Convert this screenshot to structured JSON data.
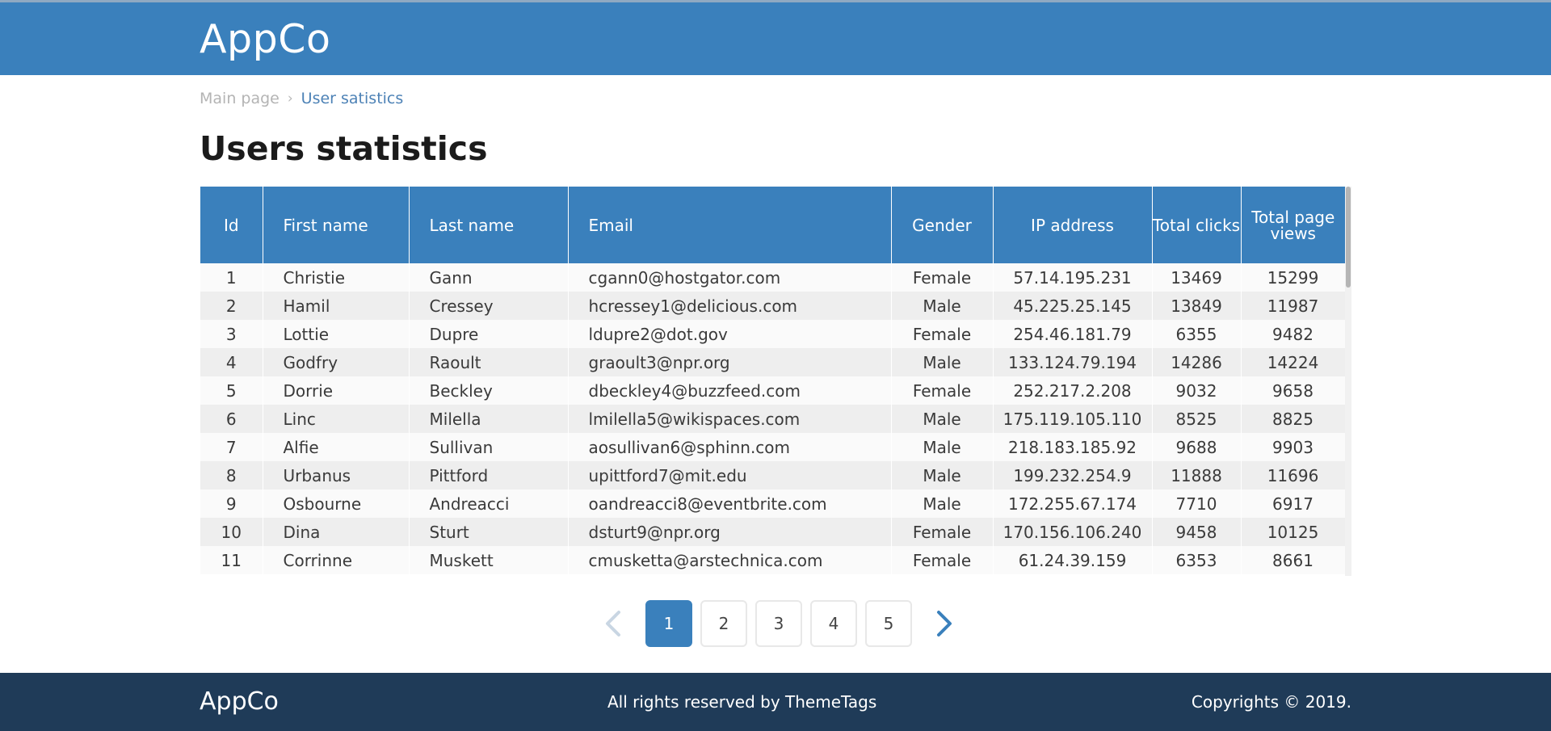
{
  "header": {
    "brand": "AppCo"
  },
  "breadcrumb": {
    "home": "Main page",
    "separator": "›",
    "current": "User satistics"
  },
  "page": {
    "title": "Users statistics"
  },
  "table": {
    "headers": [
      "Id",
      "First name",
      "Last name",
      "Email",
      "Gender",
      "IP address",
      "Total clicks",
      "Total page views"
    ],
    "rows": [
      [
        "1",
        "Christie",
        "Gann",
        "cgann0@hostgator.com",
        "Female",
        "57.14.195.231",
        "13469",
        "15299"
      ],
      [
        "2",
        "Hamil",
        "Cressey",
        "hcressey1@delicious.com",
        "Male",
        "45.225.25.145",
        "13849",
        "11987"
      ],
      [
        "3",
        "Lottie",
        "Dupre",
        "ldupre2@dot.gov",
        "Female",
        "254.46.181.79",
        "6355",
        "9482"
      ],
      [
        "4",
        "Godfry",
        "Raoult",
        "graoult3@npr.org",
        "Male",
        "133.124.79.194",
        "14286",
        "14224"
      ],
      [
        "5",
        "Dorrie",
        "Beckley",
        "dbeckley4@buzzfeed.com",
        "Female",
        "252.217.2.208",
        "9032",
        "9658"
      ],
      [
        "6",
        "Linc",
        "Milella",
        "lmilella5@wikispaces.com",
        "Male",
        "175.119.105.110",
        "8525",
        "8825"
      ],
      [
        "7",
        "Alfie",
        "Sullivan",
        "aosullivan6@sphinn.com",
        "Male",
        "218.183.185.92",
        "9688",
        "9903"
      ],
      [
        "8",
        "Urbanus",
        "Pittford",
        "upittford7@mit.edu",
        "Male",
        "199.232.254.9",
        "11888",
        "11696"
      ],
      [
        "9",
        "Osbourne",
        "Andreacci",
        "oandreacci8@eventbrite.com",
        "Male",
        "172.255.67.174",
        "7710",
        "6917"
      ],
      [
        "10",
        "Dina",
        "Sturt",
        "dsturt9@npr.org",
        "Female",
        "170.156.106.240",
        "9458",
        "10125"
      ],
      [
        "11",
        "Corrinne",
        "Muskett",
        "cmusketta@arstechnica.com",
        "Female",
        "61.24.39.159",
        "6353",
        "8661"
      ]
    ]
  },
  "pagination": {
    "prev_icon": "chevron-left-icon",
    "next_icon": "chevron-right-icon",
    "pages": [
      "1",
      "2",
      "3",
      "4",
      "5"
    ],
    "current": "1"
  },
  "footer": {
    "brand": "AppCo",
    "rights": "All rights reserved by ThemeTags",
    "copyright": "Copyrights © 2019."
  },
  "colors": {
    "primary": "#3a80bc",
    "footer_bg": "#1f3b58",
    "row_odd": "#fafafa",
    "row_even": "#eeeeee"
  }
}
